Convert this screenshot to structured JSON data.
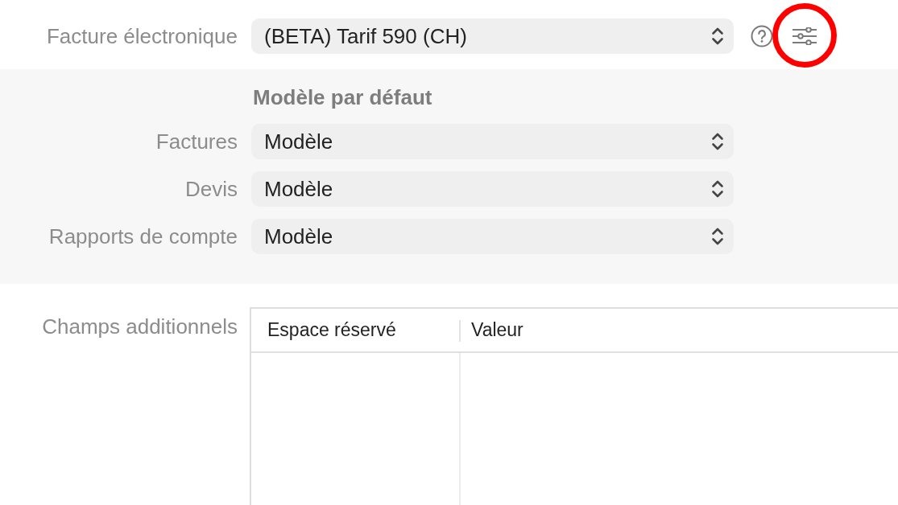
{
  "e_invoice": {
    "label": "Facture électronique",
    "value": "(BETA) Tarif 590 (CH)",
    "settings_button": {
      "highlighted": true
    }
  },
  "default_templates": {
    "heading": "Modèle par défaut",
    "rows": [
      {
        "label": "Factures",
        "value": "Modèle"
      },
      {
        "label": "Devis",
        "value": "Modèle"
      },
      {
        "label": "Rapports de compte",
        "value": "Modèle"
      }
    ]
  },
  "additional_fields": {
    "label": "Champs additionnels",
    "table": {
      "columns": [
        "Espace réservé",
        "Valeur"
      ]
    }
  }
}
